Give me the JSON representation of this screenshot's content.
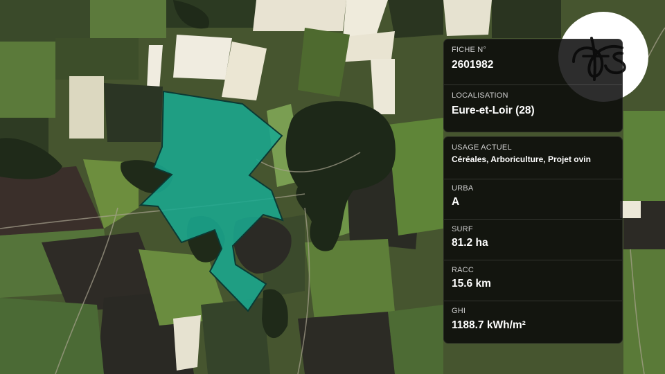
{
  "map": {
    "parcel_fill": "#1aa88f",
    "parcel_stroke": "#0b3a34",
    "forest_color": "#1f2a1a"
  },
  "card_top": {
    "fiche_label": "FICHE N°",
    "fiche_value": "2601982",
    "localisation_label": "LOCALISATION",
    "localisation_value": "Eure-et-Loir (28)"
  },
  "card_bottom": {
    "usage_label": "USAGE ACTUEL",
    "usage_value": "Céréales, Arboriculture, Projet ovin",
    "urba_label": "URBA",
    "urba_value": "A",
    "surf_label": "SURF",
    "surf_value": "81.2 ha",
    "racc_label": "RACC",
    "racc_value": "15.6 km",
    "ghi_label": "GHI",
    "ghi_value": "1188.7 kWh/m²"
  },
  "logo": {
    "text": "fs",
    "icon": "fs-logo-icon"
  }
}
